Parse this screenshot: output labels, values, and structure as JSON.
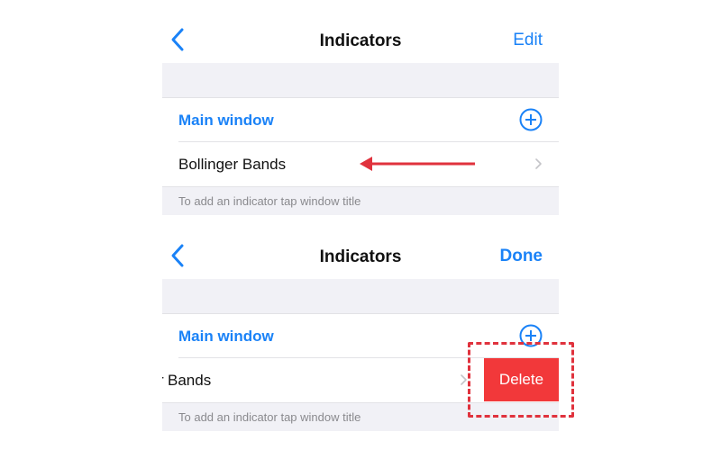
{
  "top": {
    "title": "Indicators",
    "action": "Edit",
    "section_title": "Main window",
    "item_label": "Bollinger Bands",
    "footer": "To add an indicator tap window title"
  },
  "bottom": {
    "title": "Indicators",
    "action": "Done",
    "section_title": "Main window",
    "item_label": "Bands",
    "item_label_prefix": "r",
    "delete_label": "Delete",
    "footer": "To add an indicator tap window title"
  },
  "colors": {
    "accent": "#1a82f7",
    "delete": "#f2383a",
    "annotation": "#e0323d",
    "band": "#f1f1f6"
  },
  "icons": {
    "back": "chevron-left-icon",
    "add": "plus-circle-icon",
    "disclosure": "chevron-right-icon",
    "annotation_arrow": "arrow-left-icon"
  }
}
